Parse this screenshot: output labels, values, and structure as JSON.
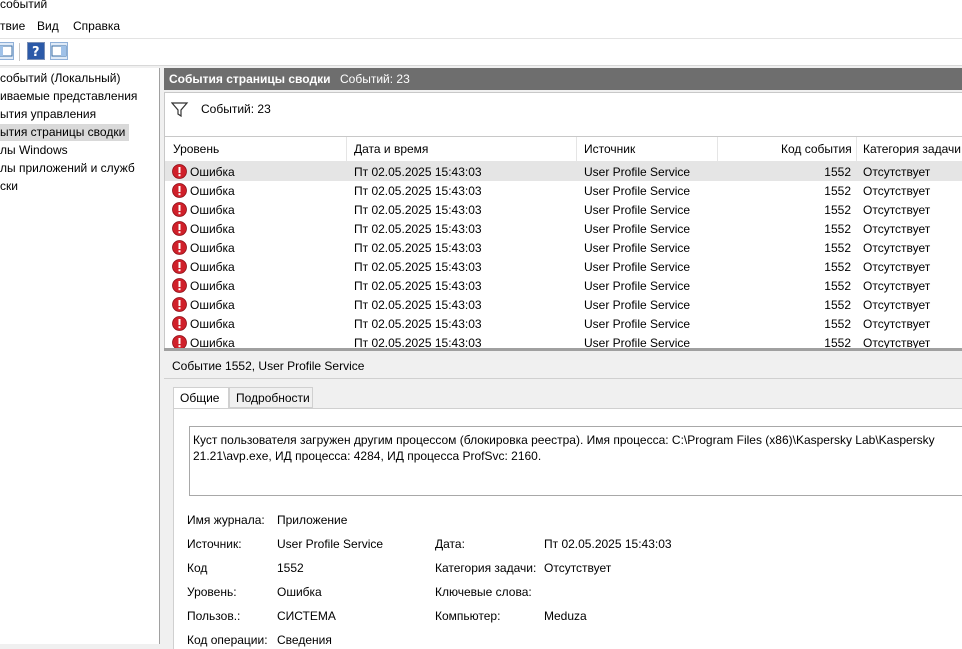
{
  "window": {
    "title": "событий"
  },
  "menu": {
    "items": [
      "твие",
      "Вид",
      "Справка"
    ]
  },
  "tree": {
    "items": [
      {
        "label": "событий (Локальный)"
      },
      {
        "label": "иваемые представления"
      },
      {
        "label": "ытия управления"
      },
      {
        "label": "ытия страницы сводки"
      },
      {
        "label": "лы Windows"
      },
      {
        "label": "лы приложений и служб"
      },
      {
        "label": "ски"
      }
    ]
  },
  "panel": {
    "title": "События страницы сводки",
    "count": "Событий: 23"
  },
  "filter": {
    "count": "Событий: 23"
  },
  "table": {
    "columns": [
      "Уровень",
      "Дата и время",
      "Источник",
      "Код события",
      "Категория задачи"
    ],
    "rows": [
      {
        "level": "Ошибка",
        "datetime": "Пт 02.05.2025 15:43:03",
        "source": "User Profile Service",
        "event_id": "1552",
        "category": "Отсутствует"
      },
      {
        "level": "Ошибка",
        "datetime": "Пт 02.05.2025 15:43:03",
        "source": "User Profile Service",
        "event_id": "1552",
        "category": "Отсутствует"
      },
      {
        "level": "Ошибка",
        "datetime": "Пт 02.05.2025 15:43:03",
        "source": "User Profile Service",
        "event_id": "1552",
        "category": "Отсутствует"
      },
      {
        "level": "Ошибка",
        "datetime": "Пт 02.05.2025 15:43:03",
        "source": "User Profile Service",
        "event_id": "1552",
        "category": "Отсутствует"
      },
      {
        "level": "Ошибка",
        "datetime": "Пт 02.05.2025 15:43:03",
        "source": "User Profile Service",
        "event_id": "1552",
        "category": "Отсутствует"
      },
      {
        "level": "Ошибка",
        "datetime": "Пт 02.05.2025 15:43:03",
        "source": "User Profile Service",
        "event_id": "1552",
        "category": "Отсутствует"
      },
      {
        "level": "Ошибка",
        "datetime": "Пт 02.05.2025 15:43:03",
        "source": "User Profile Service",
        "event_id": "1552",
        "category": "Отсутствует"
      },
      {
        "level": "Ошибка",
        "datetime": "Пт 02.05.2025 15:43:03",
        "source": "User Profile Service",
        "event_id": "1552",
        "category": "Отсутствует"
      },
      {
        "level": "Ошибка",
        "datetime": "Пт 02.05.2025 15:43:03",
        "source": "User Profile Service",
        "event_id": "1552",
        "category": "Отсутствует"
      },
      {
        "level": "Ошибка",
        "datetime": "Пт 02.05.2025 15:43:03",
        "source": "User Profile Service",
        "event_id": "1552",
        "category": "Отсутствует"
      }
    ]
  },
  "detail": {
    "title": "Событие 1552, User Profile Service",
    "tabs": [
      "Общие",
      "Подробности"
    ],
    "message": "Куст пользователя загружен другим процессом (блокировка реестра). Имя процесса: C:\\Program Files (x86)\\Kaspersky Lab\\Kaspersky 21.21\\avp.exe, ИД процесса: 4284, ИД процесса ProfSvc: 2160.",
    "fields": {
      "log_name_label": "Имя журнала:",
      "log_name": "Приложение",
      "source_label": "Источник:",
      "source": "User Profile Service",
      "date_label": "Дата:",
      "date": "Пт 02.05.2025 15:43:03",
      "code_label": "Код",
      "code": "1552",
      "task_category_label": "Категория задачи:",
      "task_category": "Отсутствует",
      "level_label": "Уровень:",
      "level": "Ошибка",
      "keywords_label": "Ключевые слова:",
      "keywords": "",
      "user_label": "Пользов.:",
      "user": "СИСТЕМА",
      "computer_label": "Компьютер:",
      "computer": "Meduza",
      "opcode_label": "Код операции:",
      "opcode": "Сведения"
    }
  },
  "icons": {
    "error": "error-icon",
    "filter": "filter-icon",
    "help": "help-icon"
  },
  "colors": {
    "error": "#d0202a",
    "panel_header": "#6e6e6e",
    "selected_row": "#e5e5e5"
  }
}
